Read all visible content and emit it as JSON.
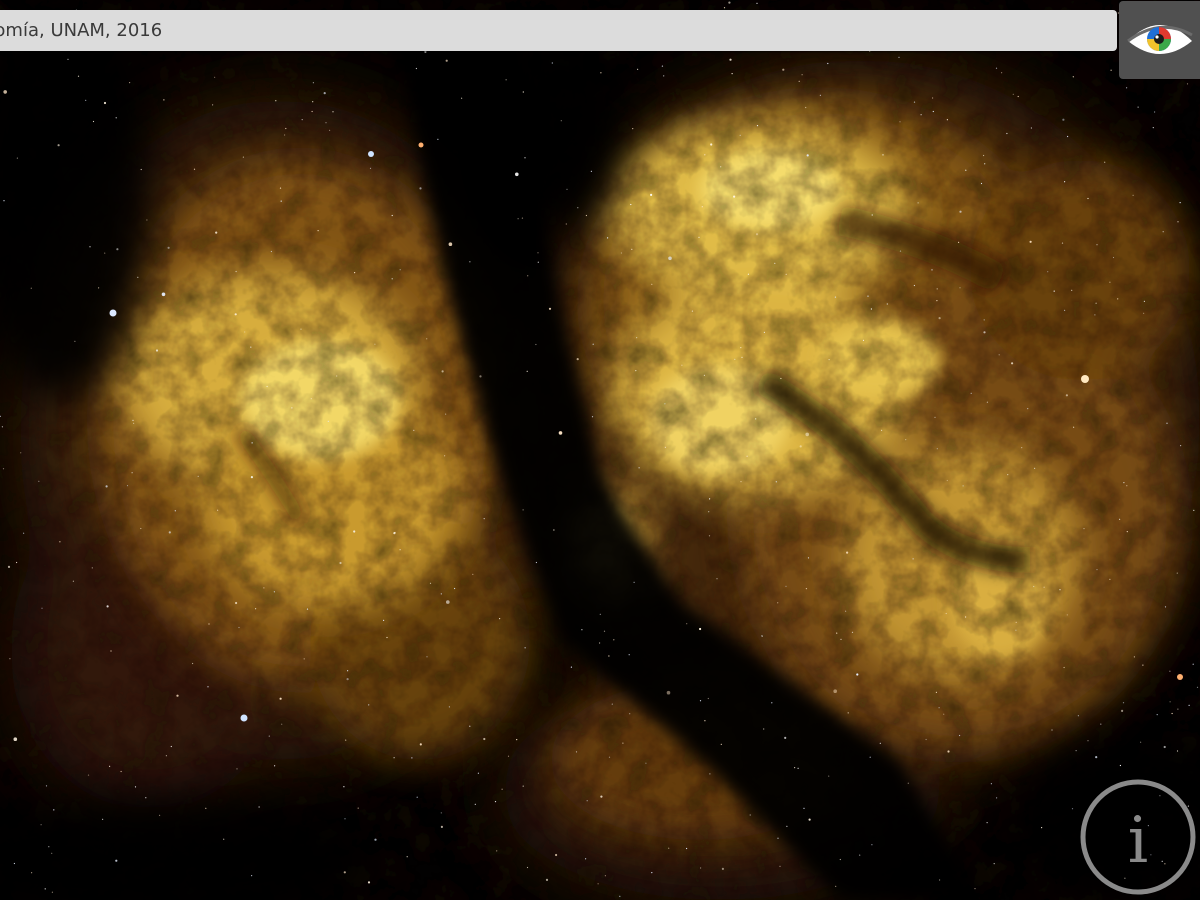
{
  "caption": {
    "text": "onomía, UNAM, 2016"
  },
  "controls": {
    "view_toggle_icon": "eye-icon",
    "info_icon": "info-icon",
    "info_glyph": "i"
  },
  "colors": {
    "caption_bg": "#dcdcdc",
    "caption_text": "#3a3a3a",
    "eye_button_bg": "#505050",
    "info_ring": "#8a8a8a",
    "nebula_gold": "#e8c04a",
    "space_black": "#000000"
  }
}
